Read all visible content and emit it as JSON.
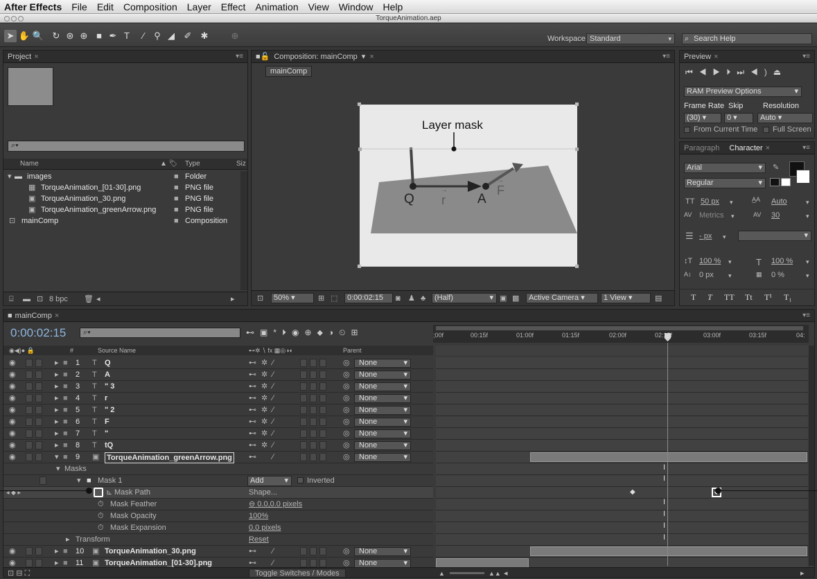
{
  "menubar": {
    "app": "After Effects",
    "items": [
      "File",
      "Edit",
      "Composition",
      "Layer",
      "Effect",
      "Animation",
      "View",
      "Window",
      "Help"
    ]
  },
  "window": {
    "title": "TorqueAnimation.aep"
  },
  "toolbar": {
    "workspace_label": "Workspace:",
    "workspace_value": "Standard",
    "search_placeholder": "Search Help"
  },
  "project": {
    "tab": "Project",
    "col_name": "Name",
    "col_type": "Type",
    "col_size": "Siz",
    "bpc": "8 bpc",
    "items": [
      {
        "name": "images",
        "type": "Folder"
      },
      {
        "name": "TorqueAnimation_[01-30].png",
        "type": "PNG file"
      },
      {
        "name": "TorqueAnimation_30.png",
        "type": "PNG file"
      },
      {
        "name": "TorqueAnimation_greenArrow.png",
        "type": "PNG file"
      },
      {
        "name": "mainComp",
        "type": "Composition"
      }
    ]
  },
  "comp": {
    "tab": "Composition: mainComp",
    "subtab": "mainComp",
    "annotation": "Layer mask",
    "labels": {
      "q": "Q",
      "r": "r",
      "a": "A",
      "f": "F"
    },
    "zoom": "50%",
    "timecode": "0:00:02:15",
    "resolution": "(Half)",
    "camera": "Active Camera",
    "views": "1 View"
  },
  "preview": {
    "tab": "Preview",
    "ram_options": "RAM Preview Options",
    "frame_rate_label": "Frame Rate",
    "skip_label": "Skip",
    "resolution_label": "Resolution",
    "frame_rate": "(30)",
    "skip": "0",
    "resolution": "Auto",
    "from_current": "From Current Time",
    "full_screen": "Full Screen"
  },
  "character": {
    "tab_paragraph": "Paragraph",
    "tab_character": "Character",
    "font": "Arial",
    "style": "Regular",
    "size": "50 px",
    "leading": "Auto",
    "kerning": "Metrics",
    "tracking": "30",
    "stroke": "- px",
    "vscale": "100 %",
    "hscale": "100 %",
    "baseline": "0 px",
    "tsume": "0 %",
    "styles": [
      "T",
      "T",
      "TT",
      "Tt",
      "T¹",
      "T₁"
    ]
  },
  "timeline": {
    "tab": "mainComp",
    "timecode": "0:00:02:15",
    "col_source": "Source Name",
    "col_parent": "Parent",
    "toggle_label": "Toggle Switches / Modes",
    "ruler": [
      ";00f",
      "00:15f",
      "01:00f",
      "01:15f",
      "02:00f",
      "02:15f",
      "03:00f",
      "03:15f",
      "04:"
    ],
    "layers": [
      {
        "num": "1",
        "name": "Q",
        "parent": "None",
        "kind": "text"
      },
      {
        "num": "2",
        "name": "A",
        "parent": "None",
        "kind": "text"
      },
      {
        "num": "3",
        "name": "\" 3",
        "parent": "None",
        "kind": "text"
      },
      {
        "num": "4",
        "name": "r",
        "parent": "None",
        "kind": "text"
      },
      {
        "num": "5",
        "name": "\" 2",
        "parent": "None",
        "kind": "text"
      },
      {
        "num": "6",
        "name": "F",
        "parent": "None",
        "kind": "text"
      },
      {
        "num": "7",
        "name": "\"",
        "parent": "None",
        "kind": "text"
      },
      {
        "num": "8",
        "name": "tQ",
        "parent": "None",
        "kind": "text"
      },
      {
        "num": "9",
        "name": "TorqueAnimation_greenArrow.png",
        "parent": "None",
        "kind": "image"
      }
    ],
    "masks_label": "Masks",
    "mask1": "Mask 1",
    "mask_mode": "Add",
    "inverted": "Inverted",
    "props": [
      {
        "name": "Mask Path",
        "value": "Shape..."
      },
      {
        "name": "Mask Feather",
        "value": "0.0,0.0 pixels"
      },
      {
        "name": "Mask Opacity",
        "value": "100%"
      },
      {
        "name": "Mask Expansion",
        "value": "0.0 pixels"
      }
    ],
    "transform": "Transform",
    "transform_value": "Reset",
    "layers_bottom": [
      {
        "num": "10",
        "name": "TorqueAnimation_30.png",
        "parent": "None"
      },
      {
        "num": "11",
        "name": "TorqueAnimation_[01-30].png",
        "parent": "None"
      }
    ]
  }
}
